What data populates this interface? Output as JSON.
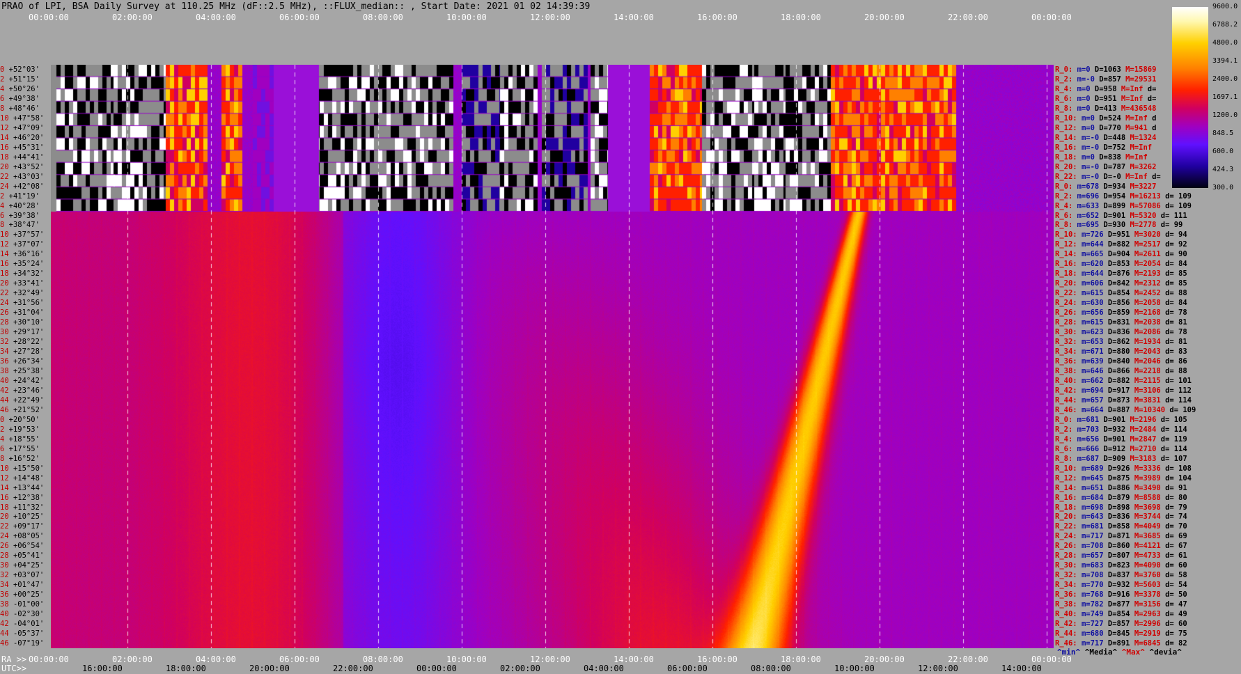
{
  "header": {
    "title": "PRAO of LPI, BSA Daily Survey at 110.25 MHz (dF::2.5 MHz), ::FLUX_median:: , Start Date: 2021 01 02 14:39:39"
  },
  "top_axis_ticks": [
    "00:00:00",
    "02:00:00",
    "04:00:00",
    "06:00:00",
    "08:00:00",
    "10:00:00",
    "12:00:00",
    "14:00:00",
    "16:00:00",
    "18:00:00",
    "20:00:00",
    "22:00:00",
    "00:00:00"
  ],
  "bottom_axis": {
    "ra_label": "RA >>",
    "utc_label": "UTC>>",
    "ra_ticks": [
      "00:00:00",
      "02:00:00",
      "04:00:00",
      "06:00:00",
      "08:00:00",
      "10:00:00",
      "12:00:00",
      "14:00:00",
      "16:00:00",
      "18:00:00",
      "20:00:00",
      "22:00:00",
      "00:00:00"
    ],
    "utc_ticks": [
      "16:00:00",
      "18:00:00",
      "20:00:00",
      "22:00:00",
      "00:00:00",
      "02:00:00",
      "04:00:00",
      "06:00:00",
      "08:00:00",
      "10:00:00",
      "12:00:00",
      "14:00:00"
    ]
  },
  "colorbar": {
    "labels": [
      "9600.0",
      "6788.2",
      "4800.0",
      "3394.1",
      "2400.0",
      "1697.1",
      "1200.0",
      "848.5",
      "600.0",
      "424.3",
      "300.0"
    ]
  },
  "declinations": [
    {
      "i": "0",
      "d": "+52°03'"
    },
    {
      "i": "2",
      "d": "+51°15'"
    },
    {
      "i": "4",
      "d": "+50°26'"
    },
    {
      "i": "6",
      "d": "+49°38'"
    },
    {
      "i": "8",
      "d": "+48°46'"
    },
    {
      "i": "10",
      "d": "+47°58'"
    },
    {
      "i": "12",
      "d": "+47°09'"
    },
    {
      "i": "14",
      "d": "+46°20'"
    },
    {
      "i": "16",
      "d": "+45°31'"
    },
    {
      "i": "18",
      "d": "+44°41'"
    },
    {
      "i": "20",
      "d": "+43°52'"
    },
    {
      "i": "22",
      "d": "+43°03'"
    },
    {
      "i": "24",
      "d": "+42°08'"
    },
    {
      "i": "2",
      "d": "+41°19'"
    },
    {
      "i": "4",
      "d": "+40°28'"
    },
    {
      "i": "6",
      "d": "+39°38'"
    },
    {
      "i": "8",
      "d": "+38°47'"
    },
    {
      "i": "10",
      "d": "+37°57'"
    },
    {
      "i": "12",
      "d": "+37°07'"
    },
    {
      "i": "14",
      "d": "+36°16'"
    },
    {
      "i": "16",
      "d": "+35°24'"
    },
    {
      "i": "18",
      "d": "+34°32'"
    },
    {
      "i": "20",
      "d": "+33°41'"
    },
    {
      "i": "22",
      "d": "+32°49'"
    },
    {
      "i": "24",
      "d": "+31°56'"
    },
    {
      "i": "26",
      "d": "+31°04'"
    },
    {
      "i": "28",
      "d": "+30°10'"
    },
    {
      "i": "30",
      "d": "+29°17'"
    },
    {
      "i": "32",
      "d": "+28°22'"
    },
    {
      "i": "34",
      "d": "+27°28'"
    },
    {
      "i": "36",
      "d": "+26°34'"
    },
    {
      "i": "38",
      "d": "+25°38'"
    },
    {
      "i": "40",
      "d": "+24°42'"
    },
    {
      "i": "42",
      "d": "+23°46'"
    },
    {
      "i": "44",
      "d": "+22°49'"
    },
    {
      "i": "46",
      "d": "+21°52'"
    },
    {
      "i": "0",
      "d": "+20°50'"
    },
    {
      "i": "2",
      "d": "+19°53'"
    },
    {
      "i": "4",
      "d": "+18°55'"
    },
    {
      "i": "6",
      "d": "+17°55'"
    },
    {
      "i": "8",
      "d": "+16°52'"
    },
    {
      "i": "10",
      "d": "+15°50'"
    },
    {
      "i": "12",
      "d": "+14°48'"
    },
    {
      "i": "14",
      "d": "+13°44'"
    },
    {
      "i": "16",
      "d": "+12°38'"
    },
    {
      "i": "18",
      "d": "+11°32'"
    },
    {
      "i": "20",
      "d": "+10°25'"
    },
    {
      "i": "22",
      "d": "+09°17'"
    },
    {
      "i": "24",
      "d": "+08°05'"
    },
    {
      "i": "26",
      "d": "+06°54'"
    },
    {
      "i": "28",
      "d": "+05°41'"
    },
    {
      "i": "30",
      "d": "+04°25'"
    },
    {
      "i": "32",
      "d": "+03°07'"
    },
    {
      "i": "34",
      "d": "+01°47'"
    },
    {
      "i": "36",
      "d": "+00°25'"
    },
    {
      "i": "38",
      "d": "-01°00'"
    },
    {
      "i": "40",
      "d": "-02°30'"
    },
    {
      "i": "42",
      "d": "-04°01'"
    },
    {
      "i": "44",
      "d": "-05°37'"
    },
    {
      "i": "46",
      "d": "-07°19'"
    }
  ],
  "stats": [
    {
      "r": "R_0:",
      "m": "m=0",
      "d": "D=1063",
      "M": "M=15869",
      "dev": ""
    },
    {
      "r": "R_2:",
      "m": "m=-0",
      "d": "D=857",
      "M": "M=29531",
      "dev": ""
    },
    {
      "r": "R_4:",
      "m": "m=0",
      "d": "D=958",
      "M": "M=Inf",
      "dev": "d="
    },
    {
      "r": "R_6:",
      "m": "m=0",
      "d": "D=951",
      "M": "M=Inf",
      "dev": "d="
    },
    {
      "r": "R_8:",
      "m": "m=0",
      "d": "D=413",
      "M": "M=436548",
      "dev": ""
    },
    {
      "r": "R_10:",
      "m": "m=0",
      "d": "D=524",
      "M": "M=Inf",
      "dev": "d"
    },
    {
      "r": "R_12:",
      "m": "m=0",
      "d": "D=770",
      "M": "M=941",
      "dev": "d"
    },
    {
      "r": "R_14:",
      "m": "m=-0",
      "d": "D=448",
      "M": "M=1324",
      "dev": ""
    },
    {
      "r": "R_16:",
      "m": "m=-0",
      "d": "D=752",
      "M": "M=Inf",
      "dev": ""
    },
    {
      "r": "R_18:",
      "m": "m=0",
      "d": "D=838",
      "M": "M=Inf",
      "dev": ""
    },
    {
      "r": "R_20:",
      "m": "m=-0",
      "d": "D=787",
      "M": "M=3262",
      "dev": ""
    },
    {
      "r": "R_22:",
      "m": "m=-0",
      "d": "D=-0",
      "M": "M=Inf",
      "dev": "d="
    },
    {
      "r": "R_0:",
      "m": "m=678",
      "d": "D=934",
      "M": "M=3227",
      "dev": ""
    },
    {
      "r": "R_2:",
      "m": "m=696",
      "d": "D=954",
      "M": "M=16213",
      "dev": "d= 109"
    },
    {
      "r": "R_4:",
      "m": "m=633",
      "d": "D=899",
      "M": "M=57086",
      "dev": "d= 109"
    },
    {
      "r": "R_6:",
      "m": "m=652",
      "d": "D=901",
      "M": "M=5320",
      "dev": "d= 111"
    },
    {
      "r": "R_8:",
      "m": "m=695",
      "d": "D=930",
      "M": "M=2778",
      "dev": "d= 99"
    },
    {
      "r": "R_10:",
      "m": "m=726",
      "d": "D=951",
      "M": "M=3020",
      "dev": "d= 94"
    },
    {
      "r": "R_12:",
      "m": "m=644",
      "d": "D=882",
      "M": "M=2517",
      "dev": "d= 92"
    },
    {
      "r": "R_14:",
      "m": "m=665",
      "d": "D=904",
      "M": "M=2611",
      "dev": "d= 90"
    },
    {
      "r": "R_16:",
      "m": "m=620",
      "d": "D=853",
      "M": "M=2054",
      "dev": "d= 84"
    },
    {
      "r": "R_18:",
      "m": "m=644",
      "d": "D=876",
      "M": "M=2193",
      "dev": "d= 85"
    },
    {
      "r": "R_20:",
      "m": "m=606",
      "d": "D=842",
      "M": "M=2312",
      "dev": "d= 85"
    },
    {
      "r": "R_22:",
      "m": "m=615",
      "d": "D=854",
      "M": "M=2452",
      "dev": "d= 88"
    },
    {
      "r": "R_24:",
      "m": "m=630",
      "d": "D=856",
      "M": "M=2058",
      "dev": "d= 84"
    },
    {
      "r": "R_26:",
      "m": "m=656",
      "d": "D=859",
      "M": "M=2168",
      "dev": "d= 78"
    },
    {
      "r": "R_28:",
      "m": "m=615",
      "d": "D=831",
      "M": "M=2038",
      "dev": "d= 81"
    },
    {
      "r": "R_30:",
      "m": "m=623",
      "d": "D=836",
      "M": "M=2086",
      "dev": "d= 78"
    },
    {
      "r": "R_32:",
      "m": "m=653",
      "d": "D=862",
      "M": "M=1934",
      "dev": "d= 81"
    },
    {
      "r": "R_34:",
      "m": "m=671",
      "d": "D=880",
      "M": "M=2043",
      "dev": "d= 83"
    },
    {
      "r": "R_36:",
      "m": "m=639",
      "d": "D=840",
      "M": "M=2046",
      "dev": "d= 86"
    },
    {
      "r": "R_38:",
      "m": "m=646",
      "d": "D=866",
      "M": "M=2218",
      "dev": "d= 88"
    },
    {
      "r": "R_40:",
      "m": "m=662",
      "d": "D=882",
      "M": "M=2115",
      "dev": "d= 101"
    },
    {
      "r": "R_42:",
      "m": "m=694",
      "d": "D=917",
      "M": "M=3106",
      "dev": "d= 112"
    },
    {
      "r": "R_44:",
      "m": "m=657",
      "d": "D=873",
      "M": "M=3831",
      "dev": "d= 114"
    },
    {
      "r": "R_46:",
      "m": "m=664",
      "d": "D=887",
      "M": "M=10340",
      "dev": "d= 109"
    },
    {
      "r": "R_0:",
      "m": "m=681",
      "d": "D=901",
      "M": "M=2196",
      "dev": "d= 105"
    },
    {
      "r": "R_2:",
      "m": "m=703",
      "d": "D=932",
      "M": "M=2484",
      "dev": "d= 114"
    },
    {
      "r": "R_4:",
      "m": "m=656",
      "d": "D=901",
      "M": "M=2847",
      "dev": "d= 119"
    },
    {
      "r": "R_6:",
      "m": "m=666",
      "d": "D=912",
      "M": "M=2710",
      "dev": "d= 114"
    },
    {
      "r": "R_8:",
      "m": "m=687",
      "d": "D=909",
      "M": "M=3183",
      "dev": "d= 107"
    },
    {
      "r": "R_10:",
      "m": "m=689",
      "d": "D=926",
      "M": "M=3336",
      "dev": "d= 108"
    },
    {
      "r": "R_12:",
      "m": "m=645",
      "d": "D=875",
      "M": "M=3989",
      "dev": "d= 104"
    },
    {
      "r": "R_14:",
      "m": "m=651",
      "d": "D=886",
      "M": "M=3490",
      "dev": "d= 91"
    },
    {
      "r": "R_16:",
      "m": "m=684",
      "d": "D=879",
      "M": "M=8588",
      "dev": "d= 80"
    },
    {
      "r": "R_18:",
      "m": "m=698",
      "d": "D=898",
      "M": "M=3698",
      "dev": "d= 79"
    },
    {
      "r": "R_20:",
      "m": "m=643",
      "d": "D=836",
      "M": "M=3744",
      "dev": "d= 74"
    },
    {
      "r": "R_22:",
      "m": "m=681",
      "d": "D=858",
      "M": "M=4049",
      "dev": "d= 70"
    },
    {
      "r": "R_24:",
      "m": "m=717",
      "d": "D=871",
      "M": "M=3685",
      "dev": "d= 69"
    },
    {
      "r": "R_26:",
      "m": "m=708",
      "d": "D=860",
      "M": "M=4121",
      "dev": "d= 67"
    },
    {
      "r": "R_28:",
      "m": "m=657",
      "d": "D=807",
      "M": "M=4733",
      "dev": "d= 61"
    },
    {
      "r": "R_30:",
      "m": "m=683",
      "d": "D=823",
      "M": "M=4090",
      "dev": "d= 60"
    },
    {
      "r": "R_32:",
      "m": "m=708",
      "d": "D=837",
      "M": "M=3760",
      "dev": "d= 58"
    },
    {
      "r": "R_34:",
      "m": "m=770",
      "d": "D=932",
      "M": "M=5603",
      "dev": "d= 54"
    },
    {
      "r": "R_36:",
      "m": "m=768",
      "d": "D=916",
      "M": "M=3378",
      "dev": "d= 50"
    },
    {
      "r": "R_38:",
      "m": "m=782",
      "d": "D=877",
      "M": "M=3156",
      "dev": "d= 47"
    },
    {
      "r": "R_40:",
      "m": "m=749",
      "d": "D=854",
      "M": "M=2963",
      "dev": "d= 49"
    },
    {
      "r": "R_42:",
      "m": "m=727",
      "d": "D=857",
      "M": "M=2996",
      "dev": "d= 60"
    },
    {
      "r": "R_44:",
      "m": "m=680",
      "d": "D=845",
      "M": "M=2919",
      "dev": "d= 75"
    },
    {
      "r": "R_46:",
      "m": "m=717",
      "d": "D=891",
      "M": "M=6845",
      "dev": "d= 82"
    }
  ],
  "footer": {
    "min": "^min^",
    "median": "^Media^",
    "max": "^Max^",
    "dev": "^devia^"
  }
}
